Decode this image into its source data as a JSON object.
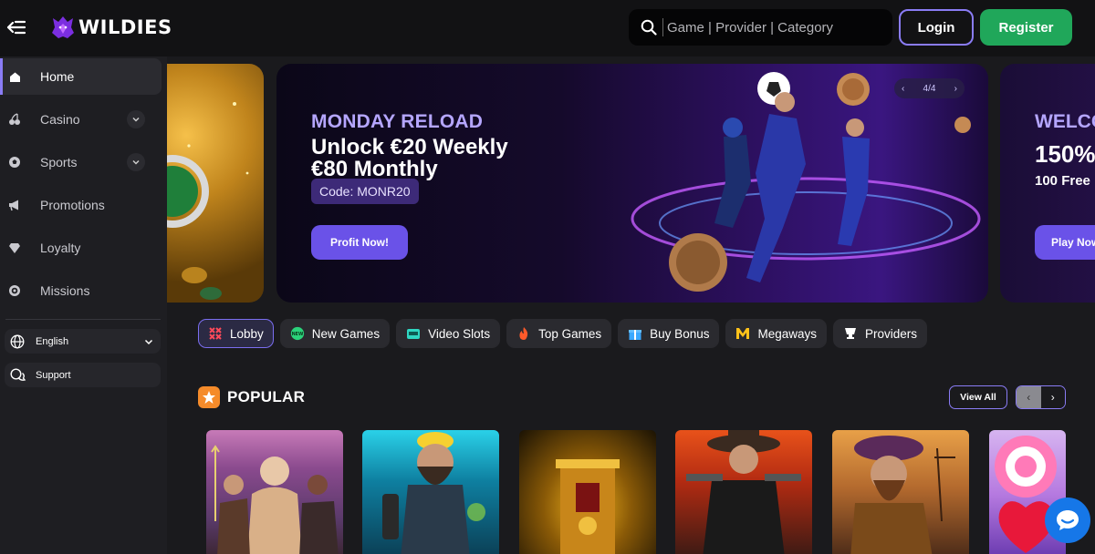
{
  "header": {
    "logo_text": "WILDIES",
    "search": {
      "placeholder": "Game | Provider | Category"
    },
    "login_label": "Login",
    "register_label": "Register"
  },
  "sidebar": {
    "items": [
      {
        "label": "Home",
        "icon": "home-icon",
        "active": true
      },
      {
        "label": "Casino",
        "icon": "cherries-icon",
        "has_chevron": true
      },
      {
        "label": "Sports",
        "icon": "soccer-ball-icon",
        "has_chevron": true
      },
      {
        "label": "Promotions",
        "icon": "megaphone-icon"
      },
      {
        "label": "Loyalty",
        "icon": "diamond-icon"
      },
      {
        "label": "Missions",
        "icon": "target-icon"
      }
    ],
    "language_label": "English",
    "support_label": "Support"
  },
  "banner": {
    "title": "MONDAY RELOAD",
    "line1": "Unlock €20 Weekly",
    "line2": "€80 Monthly",
    "code": "Code: MONR20",
    "cta": "Profit Now!",
    "slide_indicator": "4/4"
  },
  "banner_next": {
    "title": "WELCO",
    "big": "150%",
    "sub": "100 Free",
    "cta": "Play Now"
  },
  "categories": [
    {
      "label": "Lobby",
      "icon": "lobby-icon",
      "active": true
    },
    {
      "label": "New Games",
      "icon": "new-badge-icon"
    },
    {
      "label": "Video Slots",
      "icon": "slot-machine-icon"
    },
    {
      "label": "Top Games",
      "icon": "flame-icon"
    },
    {
      "label": "Buy Bonus",
      "icon": "gift-icon"
    },
    {
      "label": "Megaways",
      "icon": "megaways-icon"
    },
    {
      "label": "Providers",
      "icon": "providers-icon"
    }
  ],
  "popular": {
    "title": "POPULAR",
    "view_all": "View All"
  },
  "colors": {
    "accent": "#8a7cf5",
    "register": "#20a75a",
    "cta": "#6a52e8",
    "popular_badge": "#f58b2a",
    "chat": "#1677e8"
  }
}
